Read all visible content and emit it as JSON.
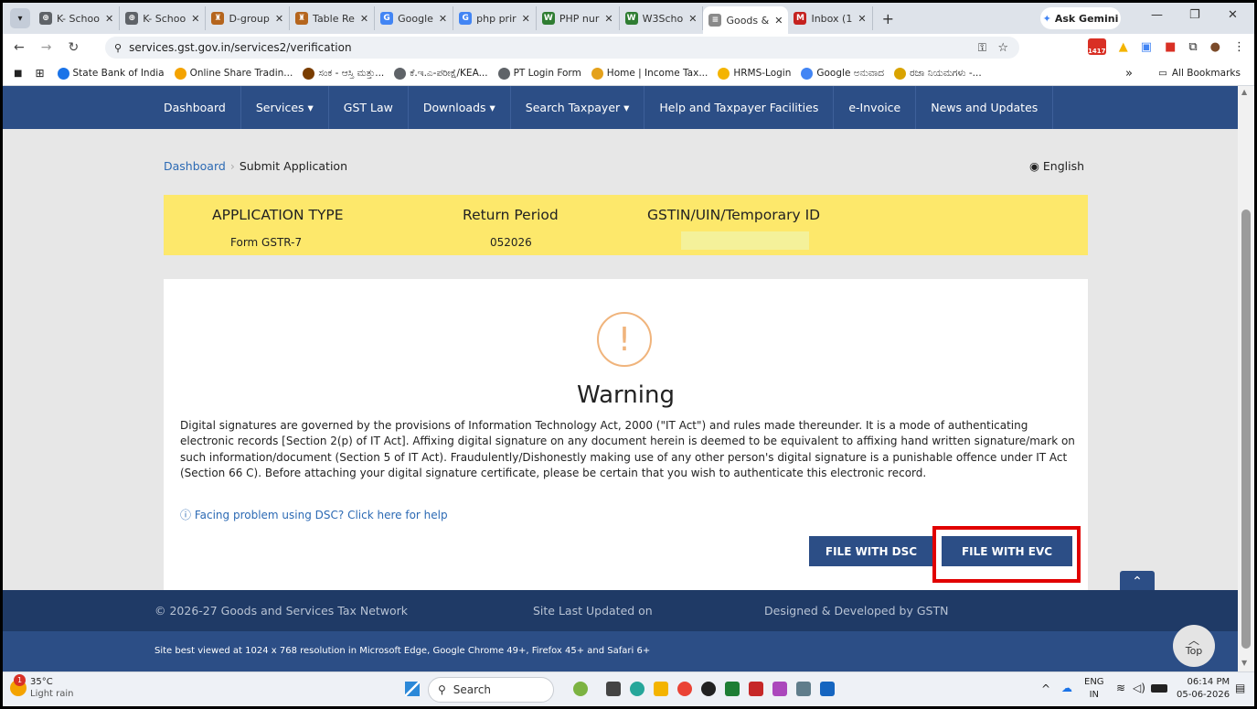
{
  "browser": {
    "tabs": [
      {
        "label": "K- Schoo",
        "color": "#5f6368",
        "glyph": "⊕"
      },
      {
        "label": "K- Schoo",
        "color": "#5f6368",
        "glyph": "⊕"
      },
      {
        "label": "D-group",
        "color": "#b5651d",
        "glyph": "♜"
      },
      {
        "label": "Table Re",
        "color": "#b5651d",
        "glyph": "♜"
      },
      {
        "label": "Google",
        "color": "#4285f4",
        "glyph": "G"
      },
      {
        "label": "php prir",
        "color": "#4285f4",
        "glyph": "G"
      },
      {
        "label": "PHP nur",
        "color": "#2f7d32",
        "glyph": "W"
      },
      {
        "label": "W3Scho",
        "color": "#2f7d32",
        "glyph": "W"
      },
      {
        "label": "Goods &",
        "color": "#8a8a8a",
        "glyph": "≡",
        "active": true
      },
      {
        "label": "Inbox (1",
        "color": "#c5221f",
        "glyph": "M"
      }
    ],
    "new_tab": "+",
    "ask_gemini": "Ask Gemini",
    "url": "services.gst.gov.in/services2/verification",
    "calendar_badge": "1417",
    "bookmarks": [
      {
        "label": "State Bank of India",
        "color": "#1a73e8"
      },
      {
        "label": "Online Share Tradin...",
        "color": "#f4a300"
      },
      {
        "label": "ಸಂಕ - ಆಸ್ತಿ ಮತ್ತು...",
        "color": "#7a3d00"
      },
      {
        "label": "ಕೆ.ಇ.ಎ-ಪರೀಕ್ಷೆ/KEA...",
        "color": "#5f6368"
      },
      {
        "label": "PT Login Form",
        "color": "#5f6368"
      },
      {
        "label": "Home | Income Tax...",
        "color": "#e4a11b"
      },
      {
        "label": "HRMS-Login",
        "color": "#f4b400"
      },
      {
        "label": "Google ಅನುವಾದ",
        "color": "#4285f4"
      },
      {
        "label": "ರಜಾ ನಿಯಮಗಳು -...",
        "color": "#d9a300"
      }
    ],
    "bookmarks_overflow": "»",
    "all_bookmarks": "All Bookmarks"
  },
  "nav": {
    "items": [
      {
        "label": "Dashboard"
      },
      {
        "label": "Services ▾"
      },
      {
        "label": "GST Law"
      },
      {
        "label": "Downloads ▾"
      },
      {
        "label": "Search Taxpayer ▾"
      },
      {
        "label": "Help and Taxpayer Facilities"
      },
      {
        "label": "e-Invoice"
      },
      {
        "label": "News and Updates"
      }
    ]
  },
  "breadcrumb": {
    "home": "Dashboard",
    "current": "Submit Application"
  },
  "language": "English",
  "application": {
    "type_header": "APPLICATION TYPE",
    "type_value": "Form GSTR-7",
    "period_header": "Return Period",
    "period_value": "052026",
    "gstin_header": "GSTIN/UIN/Temporary ID"
  },
  "warning": {
    "title": "Warning",
    "text": "Digital signatures are governed by the provisions of Information Technology Act, 2000 (\"IT Act\") and rules made thereunder. It is a mode of authenticating electronic records [Section 2(p) of IT Act]. Affixing digital signature on any document herein is deemed to be equivalent to affixing hand written signature/mark on such information/document (Section 5 of IT Act). Fraudulently/Dishonestly making use of any other person's digital signature is a punishable offence under IT Act (Section 66 C). Before attaching your digital signature certificate, please be certain that you wish to authenticate this electronic record.",
    "help_link": "Facing problem using DSC? Click here for help",
    "btn_dsc": "FILE WITH DSC",
    "btn_evc": "FILE WITH EVC"
  },
  "footer": {
    "copyright": "© 2026-27 Goods and Services Tax Network",
    "updated": "Site Last Updated on",
    "designed": "Designed & Developed by GSTN",
    "best_viewed": "Site best viewed at 1024 x 768 resolution in Microsoft Edge, Google Chrome 49+, Firefox 45+ and Safari 6+",
    "top_label": "Top"
  },
  "taskbar": {
    "weather_temp": "35°C",
    "weather_desc": "Light rain",
    "weather_badge": "1",
    "search_placeholder": "Search",
    "lang_top": "ENG",
    "lang_bottom": "IN",
    "time": "06:14 PM",
    "date": "05-06-2026"
  },
  "colors": {
    "nav_bg": "#2c4e86",
    "app_box": "#fde86b",
    "highlight": "#e10000",
    "warning_icon": "#f0b47c"
  }
}
